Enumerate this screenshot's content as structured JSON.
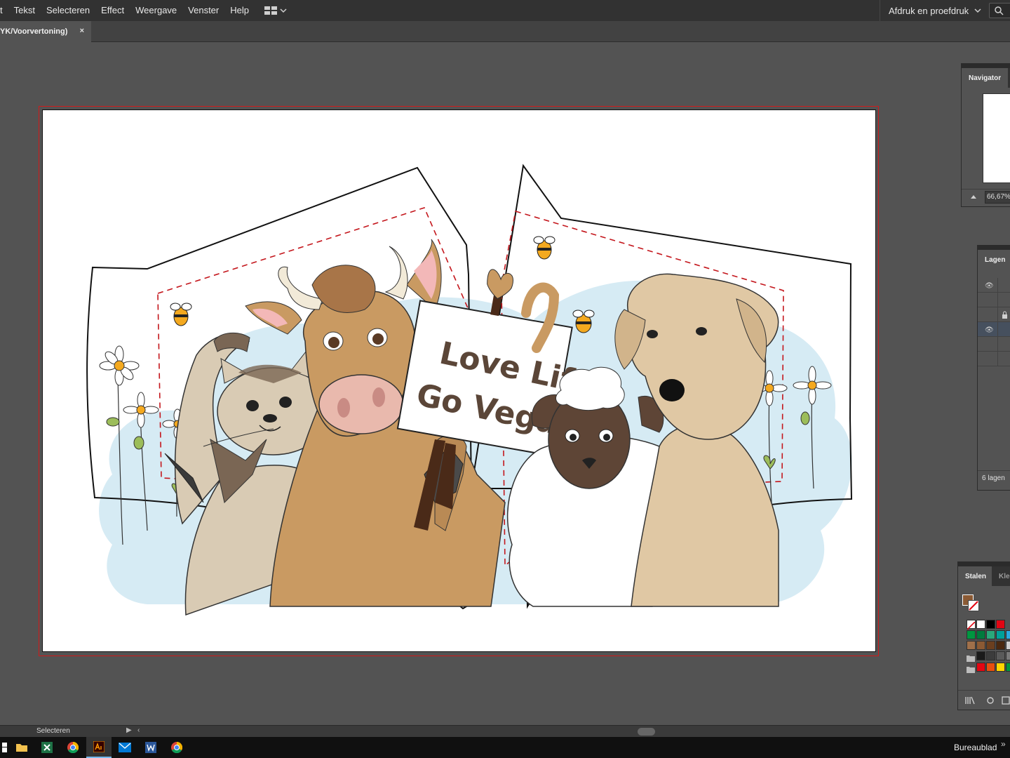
{
  "menu": {
    "items": [
      "t",
      "Tekst",
      "Selecteren",
      "Effect",
      "Weergave",
      "Venster",
      "Help"
    ]
  },
  "workspace": {
    "label": "Afdruk en proefdruk"
  },
  "document": {
    "tab_label": "YK/Voorvertoning)",
    "close_label": "×"
  },
  "artwork": {
    "sign_line1": "Love Life",
    "sign_line2": "Go Vegan"
  },
  "navigator": {
    "tab_label": "Navigator",
    "zoom": "66,67%"
  },
  "layers": {
    "tab_label": "Lagen",
    "count_label": "6 lagen"
  },
  "swatches": {
    "tab_label": "Stalen",
    "tab2_label": "Kle",
    "fill_color": "#8b5a34",
    "colors_row1": [
      "#ffffff",
      "#000000",
      "#e30613"
    ],
    "colors_row2": [
      "#009640",
      "#007a3d",
      "#2aa87b",
      "#00a19a",
      "#29abe2"
    ],
    "colors_row3": [
      "#a0704a",
      "#8b5a34",
      "#6b3f1f",
      "#4a2810",
      "#cfcfcf"
    ],
    "colors_row4": [
      "#1a1a1a",
      "#3c3c3c",
      "#5a5a5a",
      "#7a7a7a"
    ],
    "colors_row5": [
      "#e30613",
      "#e84e0f",
      "#ffd500",
      "#009640"
    ]
  },
  "status": {
    "tool_label": "Selecteren"
  },
  "taskbar": {
    "desktop_label": "Bureaublad",
    "overflow": "»"
  },
  "colors": {
    "accent": "#d11a1a",
    "panel_bg": "#535353",
    "chrome_bg": "#323232"
  }
}
